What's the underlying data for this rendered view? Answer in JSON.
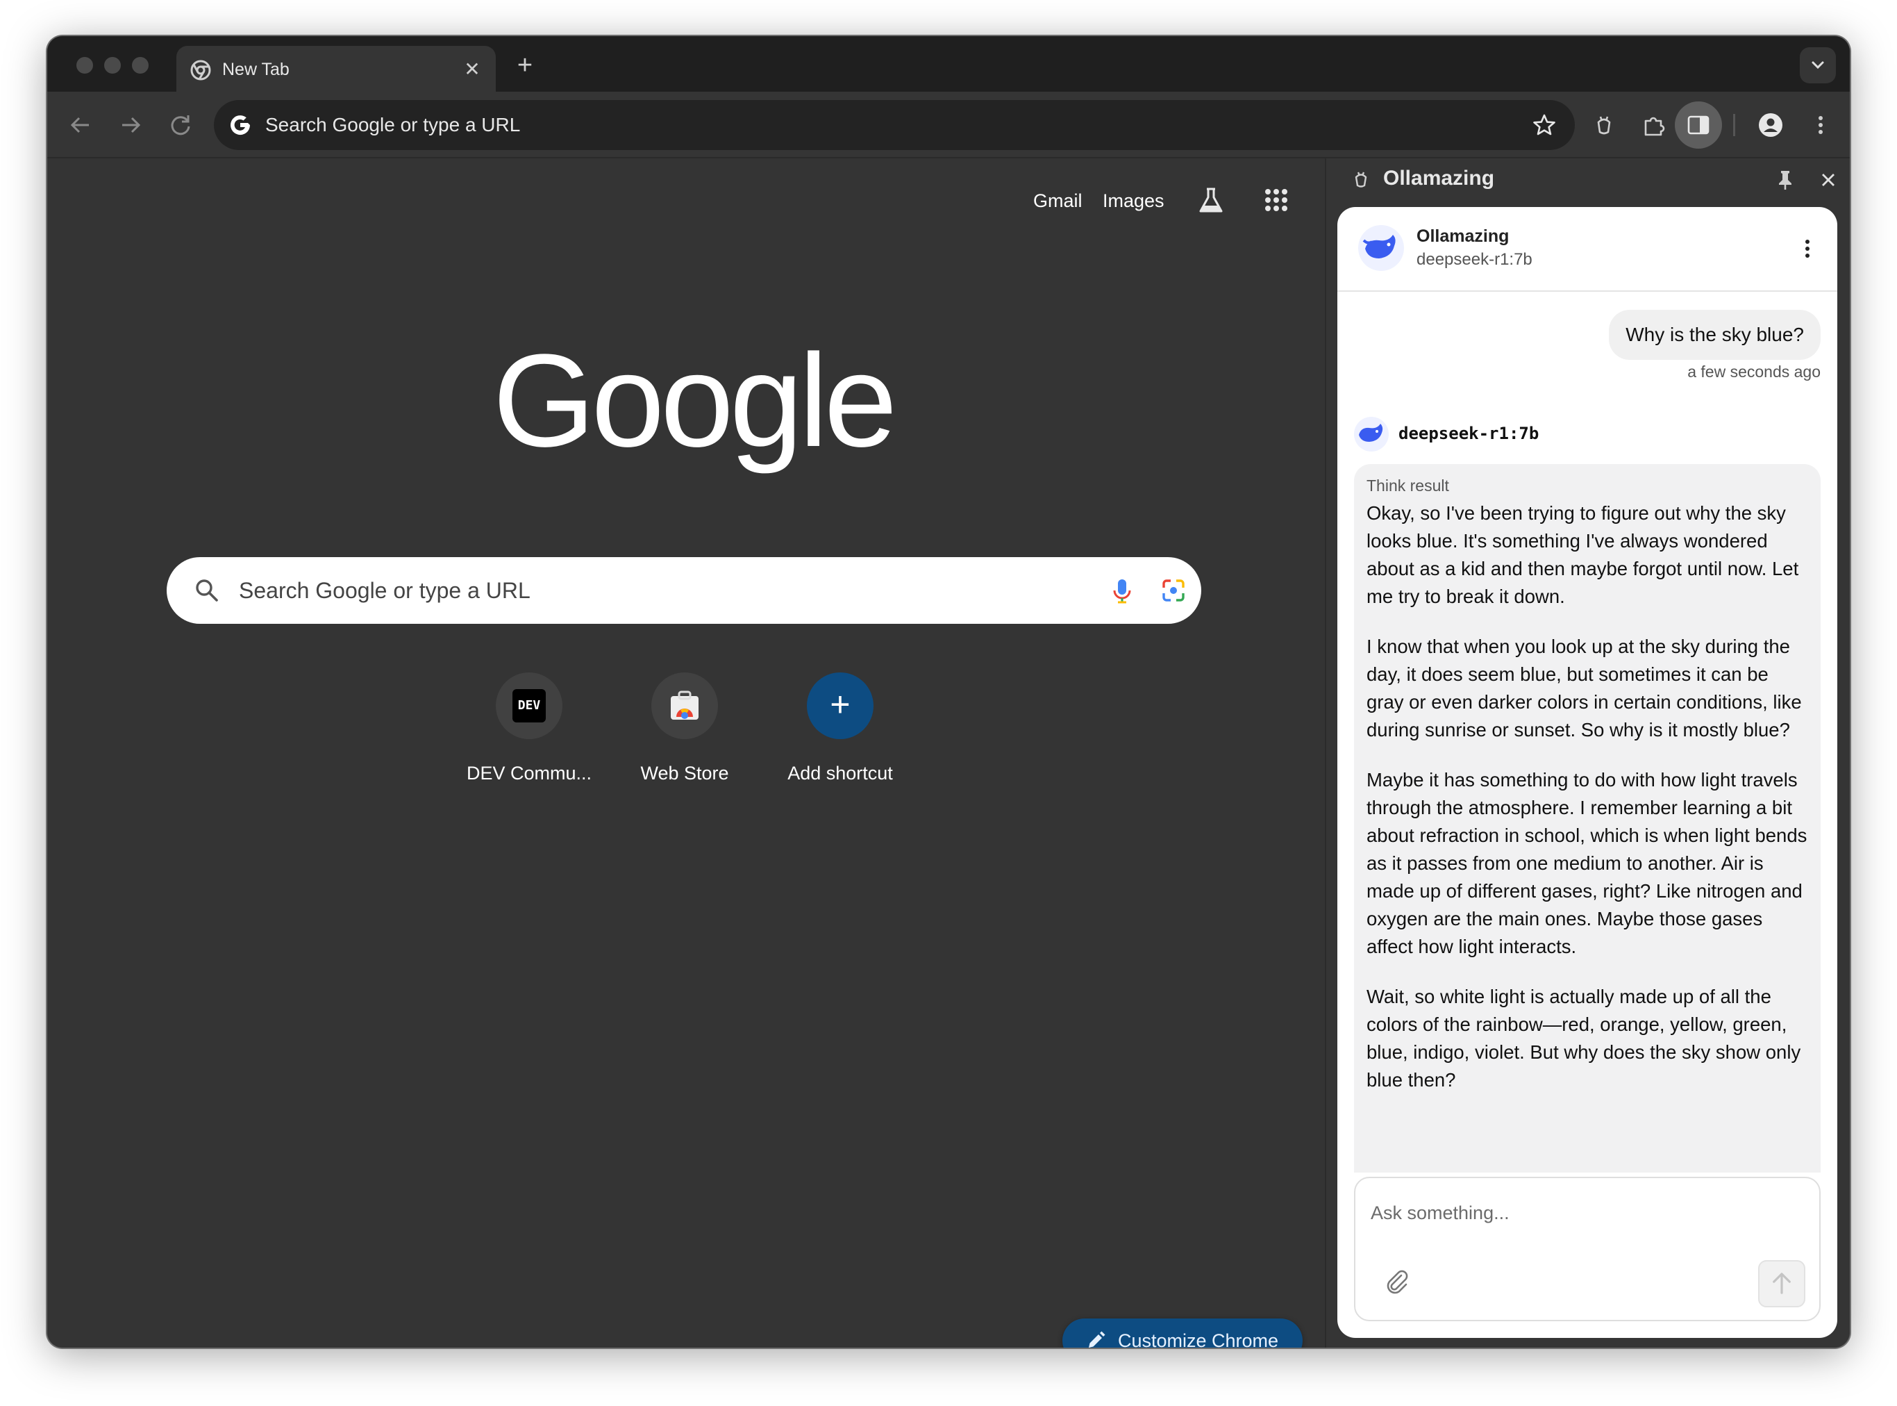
{
  "tab": {
    "title": "New Tab"
  },
  "omnibox": {
    "text": "Search Google or type a URL"
  },
  "ntp": {
    "gmail": "Gmail",
    "images": "Images",
    "logo_text": "Google",
    "search_placeholder": "Search Google or type a URL",
    "shortcuts": [
      {
        "label": "DEV Commu...",
        "icon_text": "DEV"
      },
      {
        "label": "Web Store"
      },
      {
        "label": "Add shortcut",
        "icon_text": "+"
      }
    ],
    "customize_label": "Customize Chrome"
  },
  "sidepanel": {
    "title": "Ollamazing",
    "header": {
      "name": "Ollamazing",
      "model": "deepseek-r1:7b"
    },
    "user_message": "Why is the sky blue?",
    "timestamp": "a few seconds ago",
    "bot_name": "deepseek-r1:7b",
    "think_label": "Think result",
    "paragraphs": [
      "Okay, so I've been trying to figure out why the sky looks blue. It's something I've always wondered about as a kid and then maybe forgot until now. Let me try to break it down.",
      "I know that when you look up at the sky during the day, it does seem blue, but sometimes it can be gray or even darker colors in certain conditions, like during sunrise or sunset. So why is it mostly blue?",
      "Maybe it has something to do with how light travels through the atmosphere. I remember learning a bit about refraction in school, which is when light bends as it passes from one medium to another. Air is made up of different gases, right? Like nitrogen and oxygen are the main ones. Maybe those gases affect how light interacts.",
      "Wait, so white light is actually made up of all the colors of the rainbow—red, orange, yellow, green, blue, indigo, violet. But why does the sky show only blue then?"
    ],
    "composer_placeholder": "Ask something..."
  },
  "colors": {
    "accent_blue": "#0d4c82",
    "brand_blue": "#2f5bea",
    "frame_dark": "#1f1f1f",
    "content_dark": "#343434"
  },
  "icons": {
    "back": "arrow-left-icon",
    "forward": "arrow-right-icon",
    "reload": "reload-icon",
    "star": "star-icon",
    "extension": "puzzle-icon",
    "side_panel": "side-panel-icon",
    "profile": "person-icon",
    "menu": "kebab-icon",
    "labs": "flask-icon",
    "apps": "grid-icon",
    "voice": "mic-icon",
    "lens": "lens-icon",
    "pin": "pin-icon",
    "close": "close-icon",
    "attach": "paperclip-icon",
    "send": "arrow-up-icon"
  }
}
